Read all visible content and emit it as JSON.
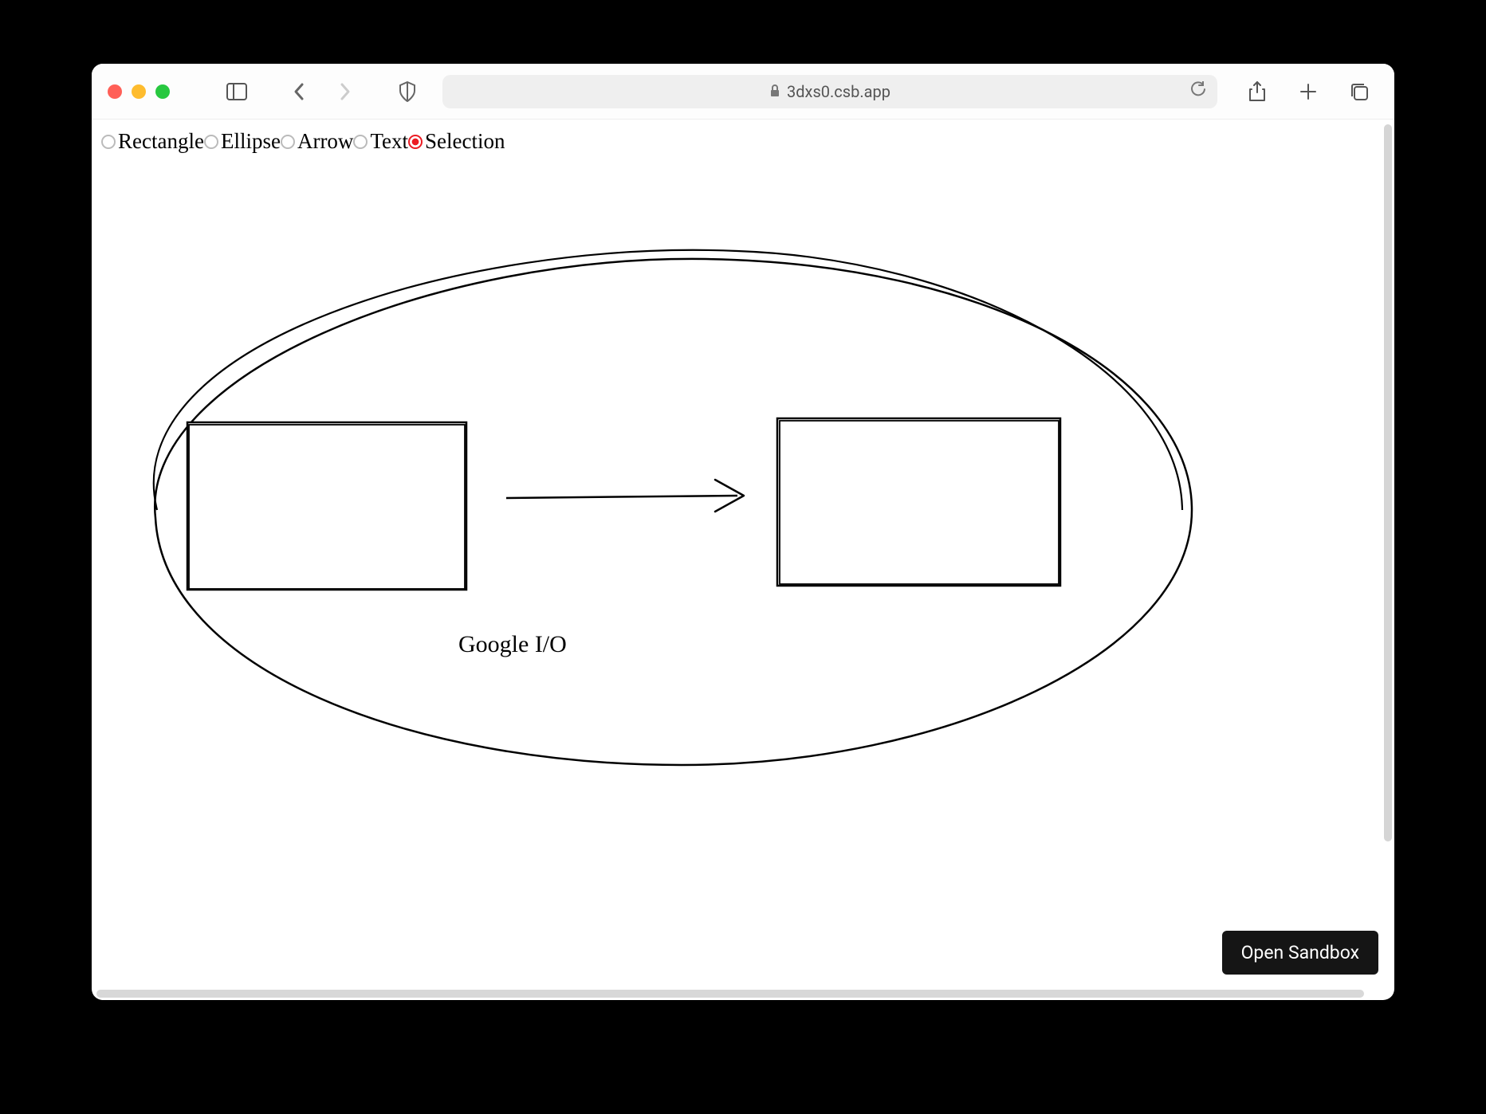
{
  "browser": {
    "url": "3dxs0.csb.app"
  },
  "toolbar": {
    "tools": [
      {
        "label": "Rectangle",
        "selected": false
      },
      {
        "label": "Ellipse",
        "selected": false
      },
      {
        "label": "Arrow",
        "selected": false
      },
      {
        "label": "Text",
        "selected": false
      },
      {
        "label": "Selection",
        "selected": true
      }
    ]
  },
  "canvas": {
    "text_label": "Google I/O"
  },
  "actions": {
    "open_sandbox": "Open Sandbox"
  }
}
